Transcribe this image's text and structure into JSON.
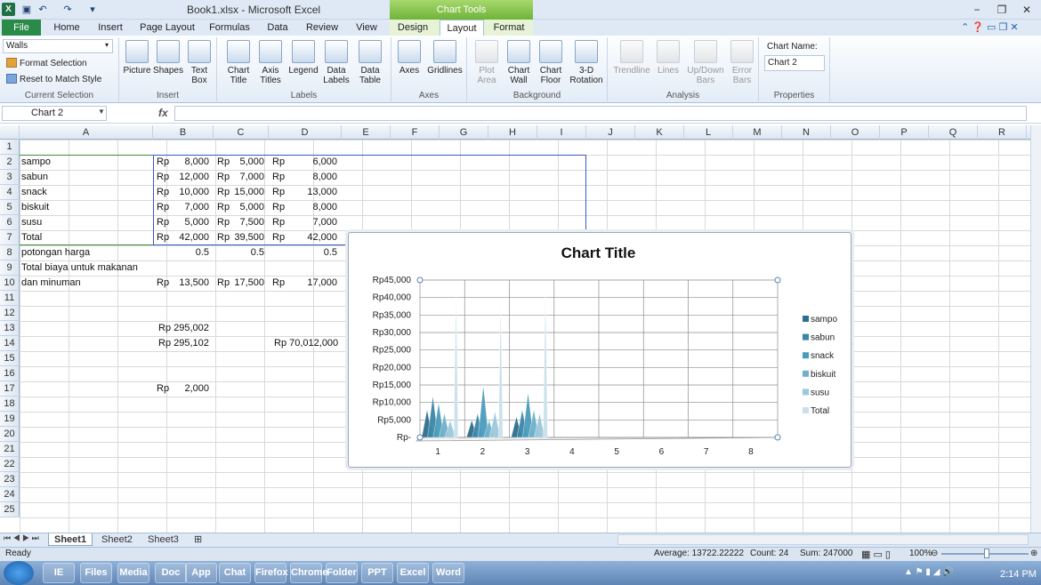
{
  "window": {
    "title": "Book1.xlsx  -  Microsoft Excel",
    "chart_tools": "Chart Tools",
    "app_icon": "X",
    "controls": [
      "−",
      "❐",
      "✕"
    ]
  },
  "tabs": [
    "File",
    "Home",
    "Insert",
    "Page Layout",
    "Formulas",
    "Data",
    "Review",
    "View",
    "Design",
    "Layout",
    "Format"
  ],
  "ribbon": {
    "current_selection": {
      "dropdown": "Walls",
      "format_selection": "Format Selection",
      "reset": "Reset to Match Style",
      "label": "Current Selection"
    },
    "insert": {
      "buttons": [
        "Picture",
        "Shapes",
        "Text Box"
      ],
      "label": "Insert"
    },
    "labels": {
      "buttons": [
        "Chart Title",
        "Axis Titles",
        "Legend",
        "Data Labels",
        "Data Table"
      ],
      "label": "Labels"
    },
    "axes": {
      "buttons": [
        "Axes",
        "Gridlines"
      ],
      "label": "Axes"
    },
    "background": {
      "buttons": [
        "Plot Area",
        "Chart Wall",
        "Chart Floor",
        "3-D Rotation"
      ],
      "label": "Background"
    },
    "analysis": {
      "buttons": [
        "Trendline",
        "Lines",
        "Up/Down Bars",
        "Error Bars"
      ],
      "label": "Analysis"
    },
    "properties": {
      "chart_name_label": "Chart Name:",
      "chart_name": "Chart 2",
      "label": "Properties"
    }
  },
  "formula": {
    "namebox": "Chart 2",
    "fx": "fx",
    "value": ""
  },
  "columns": [
    "A",
    "B",
    "C",
    "D",
    "E",
    "F",
    "G",
    "H",
    "I",
    "J",
    "K",
    "L",
    "M",
    "N",
    "O",
    "P",
    "Q",
    "R"
  ],
  "rows": [
    "1",
    "2",
    "3",
    "4",
    "5",
    "6",
    "7",
    "8",
    "9",
    "10",
    "11",
    "12",
    "13",
    "14",
    "15",
    "16",
    "17",
    "18",
    "19",
    "20",
    "21",
    "22",
    "23",
    "24",
    "25"
  ],
  "cells": {
    "A2": "sampo",
    "A3": "sabun",
    "A4": "snack",
    "A5": "biskuit",
    "A6": "susu",
    "A7": "Total",
    "A8": "potongan harga",
    "A9a": "Total biaya untuk makanan",
    "A9b": "dan minuman",
    "rp": "Rp",
    "B2": "8,000",
    "B3": "12,000",
    "B4": "10,000",
    "B5": "7,000",
    "B6": "5,000",
    "B7": "42,000",
    "C2": "5,000",
    "C3": "7,000",
    "C4": "15,000",
    "C5": "5,000",
    "C6": "7,500",
    "C7": "39,500",
    "D2": "6,000",
    "D3": "8,000",
    "D4": "13,000",
    "D5": "8,000",
    "D6": "7,000",
    "D7": "42,000",
    "B8": "0.5",
    "C8": "0.5",
    "D8": "0.5",
    "B9": "13,500",
    "C9": "17,500",
    "D9": "17,000",
    "B12": "Rp 295,002",
    "B13": "Rp 295,102",
    "D13": "Rp 70,012,000",
    "B16": "2,000"
  },
  "chart_data": {
    "type": "area",
    "title": "Chart Title",
    "categories": [
      "1",
      "2",
      "3",
      "4",
      "5",
      "6",
      "7",
      "8"
    ],
    "series": [
      {
        "name": "sampo",
        "values": [
          8000,
          5000,
          6000,
          null,
          null,
          null,
          null,
          null
        ]
      },
      {
        "name": "sabun",
        "values": [
          12000,
          7000,
          8000,
          null,
          null,
          null,
          null,
          null
        ]
      },
      {
        "name": "snack",
        "values": [
          10000,
          15000,
          13000,
          null,
          null,
          null,
          null,
          null
        ]
      },
      {
        "name": "biskuit",
        "values": [
          7000,
          5000,
          8000,
          null,
          null,
          null,
          null,
          null
        ]
      },
      {
        "name": "susu",
        "values": [
          5000,
          7500,
          7000,
          null,
          null,
          null,
          null,
          null
        ]
      },
      {
        "name": "Total",
        "values": [
          42000,
          39500,
          42000,
          null,
          null,
          null,
          null,
          null
        ]
      }
    ],
    "colors": [
      "#2f6e8e",
      "#3a86a6",
      "#4a9cbc",
      "#6fb0cb",
      "#9cc8da",
      "#c9e0ea"
    ],
    "yticks": [
      "Rp-",
      "Rp5,000",
      "Rp10,000",
      "Rp15,000",
      "Rp20,000",
      "Rp25,000",
      "Rp30,000",
      "Rp35,000",
      "Rp40,000",
      "Rp45,000"
    ],
    "ylim": [
      0,
      45000
    ],
    "grid": true,
    "legend": "right"
  },
  "sheets": [
    "Sheet1",
    "Sheet2",
    "Sheet3"
  ],
  "status": {
    "ready": "Ready",
    "average": "Average: 13722.22222",
    "count": "Count: 24",
    "sum": "Sum: 247000",
    "zoom": "100%"
  },
  "taskbar": {
    "clock": "2:14 PM",
    "apps": [
      "IE",
      "Files",
      "Media",
      "Doc",
      "App",
      "Chat",
      "Firefox",
      "Chrome",
      "Folder",
      "PPT",
      "Excel",
      "Word"
    ]
  }
}
